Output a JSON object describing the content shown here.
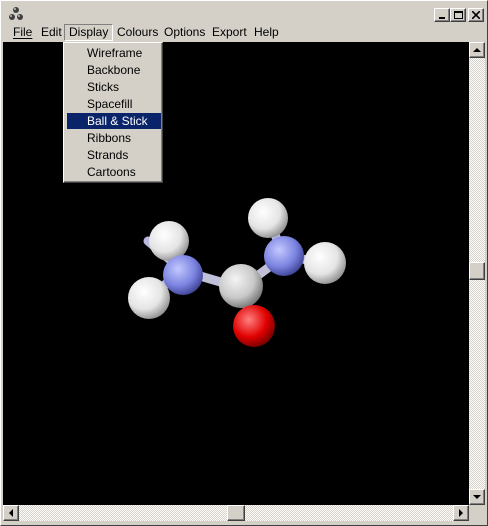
{
  "window": {
    "title": ""
  },
  "menubar": {
    "items": [
      {
        "label": "File",
        "underline": "F"
      },
      {
        "label": "Edit",
        "underline": "E"
      },
      {
        "label": "Display",
        "underline": "D"
      },
      {
        "label": "Colours",
        "underline": "C"
      },
      {
        "label": "Options",
        "underline": "O"
      },
      {
        "label": "Export",
        "underline": "x"
      },
      {
        "label": "Help",
        "underline": "H"
      }
    ]
  },
  "display_menu": {
    "items": [
      {
        "label": "Wireframe"
      },
      {
        "label": "Backbone"
      },
      {
        "label": "Sticks"
      },
      {
        "label": "Spacefill"
      },
      {
        "label": "Ball & Stick",
        "selected": true
      },
      {
        "label": "Ribbons"
      },
      {
        "label": "Strands"
      },
      {
        "label": "Cartoons"
      }
    ]
  },
  "molecule": {
    "atoms": {
      "nitrogen_color": "#7b84e0",
      "carbon_color": "#c8c8c8",
      "oxygen_color": "#e00000",
      "hydrogen_color": "#f0f0f0"
    }
  },
  "colors": {
    "canvas_bg": "#000000",
    "selection": "#0a246a",
    "chrome": "#d4d0c8"
  }
}
